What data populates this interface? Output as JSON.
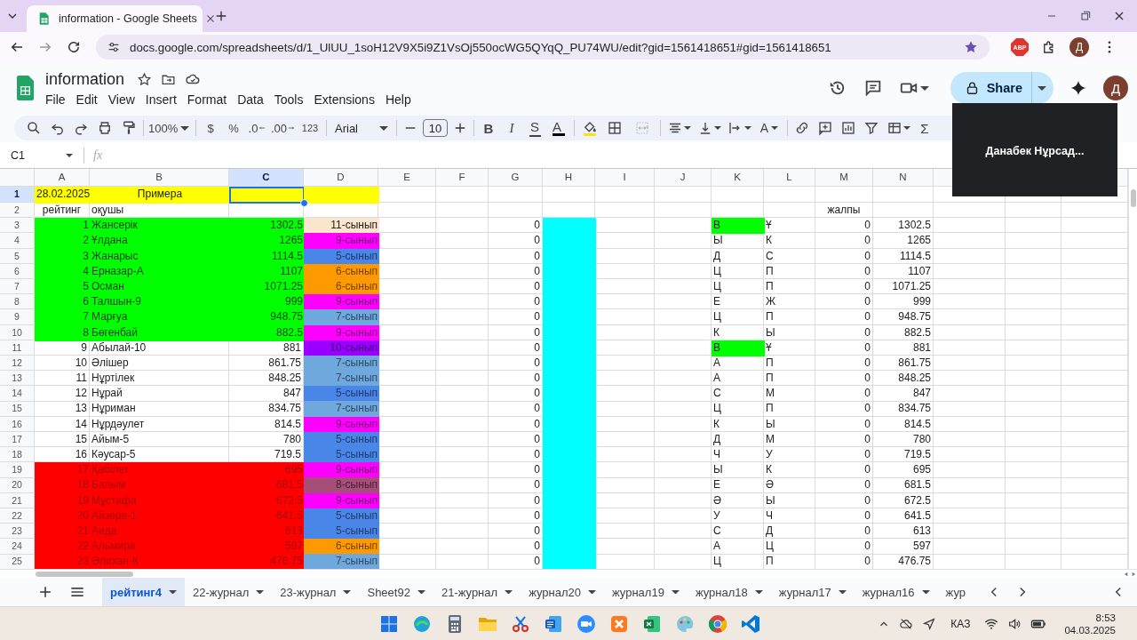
{
  "browser": {
    "tab_title": "information - Google Sheets",
    "url": "docs.google.com/spreadsheets/d/1_UlUU_1soH12V9X5i9Z1VsOj550ocWG5QYqQ_PU74WU/edit?gid=1561418651#gid=1561418651",
    "extension_badge": "ABP",
    "profile_initial": "Д"
  },
  "document": {
    "title": "information",
    "menu": [
      "File",
      "Edit",
      "View",
      "Insert",
      "Format",
      "Data",
      "Tools",
      "Extensions",
      "Help"
    ],
    "share_label": "Share",
    "account_initial": "Д"
  },
  "toolbar": {
    "zoom": "100%",
    "currency": "$",
    "percent": "%",
    "decrease_decimals": ".0",
    "increase_decimals": ".00",
    "number_format": "123",
    "font": "Arial",
    "font_size": "10",
    "bold": "B",
    "italic": "I",
    "strikethrough": "S",
    "text_color": "A",
    "text_rotation": "A",
    "sum": "Σ"
  },
  "formula_bar": {
    "cell_ref": "C1",
    "fx": "fx"
  },
  "video_tile": {
    "name": "Данабек Нұрсад..."
  },
  "grid": {
    "columns": [
      {
        "letter": "A",
        "selected": false
      },
      {
        "letter": "B",
        "selected": false
      },
      {
        "letter": "C",
        "selected": true
      },
      {
        "letter": "D",
        "selected": false
      },
      {
        "letter": "E",
        "selected": false
      },
      {
        "letter": "F",
        "selected": false
      },
      {
        "letter": "G",
        "selected": false
      },
      {
        "letter": "H",
        "selected": false
      },
      {
        "letter": "I",
        "selected": false
      },
      {
        "letter": "J",
        "selected": false
      },
      {
        "letter": "K",
        "selected": false
      },
      {
        "letter": "L",
        "selected": false
      },
      {
        "letter": "M",
        "selected": false
      },
      {
        "letter": "N",
        "selected": false
      }
    ],
    "rows": [
      {
        "number": "1",
        "selected": true,
        "kind": "title",
        "date": "28.02.2025",
        "subject": "Примера"
      },
      {
        "number": "2",
        "selected": false,
        "kind": "labels",
        "rank_label": "рейтинг",
        "name_label": "оқушы",
        "total_label": "жалпы"
      },
      {
        "number": "3",
        "selected": false,
        "kind": "leader",
        "rank": "1",
        "name": "Жансерік",
        "score": "1302.5",
        "class_label": "11-сынып",
        "color": "#fce5cd",
        "col_g": "0",
        "col_k": "В",
        "k_highlighted": true,
        "col_l": "Ұ",
        "col_m": "0",
        "col_n": "1302.5"
      },
      {
        "number": "4",
        "selected": false,
        "kind": "leader",
        "rank": "2",
        "name": "Ұлдана",
        "score": "1265",
        "class_label": "9-сынып",
        "color": "#ff00ff",
        "col_g": "0",
        "col_k": "Ы",
        "k_highlighted": false,
        "col_l": "К",
        "col_m": "0",
        "col_n": "1265"
      },
      {
        "number": "5",
        "selected": false,
        "kind": "leader",
        "rank": "3",
        "name": "Жанарыс",
        "score": "1114.5",
        "class_label": "5-сынып",
        "color": "#4a86e8",
        "col_g": "0",
        "col_k": "Д",
        "k_highlighted": false,
        "col_l": "С",
        "col_m": "0",
        "col_n": "1114.5"
      },
      {
        "number": "6",
        "selected": false,
        "kind": "leader",
        "rank": "4",
        "name": "Ерназар-А",
        "score": "1107",
        "class_label": "6-сынып",
        "color": "#ff9900",
        "col_g": "0",
        "col_k": "Ц",
        "k_highlighted": false,
        "col_l": "П",
        "col_m": "0",
        "col_n": "1107"
      },
      {
        "number": "7",
        "selected": false,
        "kind": "leader",
        "rank": "5",
        "name": "Осман",
        "score": "1071.25",
        "class_label": "6-сынып",
        "color": "#ff9900",
        "col_g": "0",
        "col_k": "Ц",
        "k_highlighted": false,
        "col_l": "П",
        "col_m": "0",
        "col_n": "1071.25"
      },
      {
        "number": "8",
        "selected": false,
        "kind": "leader",
        "rank": "6",
        "name": "Талшын-9",
        "score": "999",
        "class_label": "9-сынып",
        "color": "#ff00ff",
        "col_g": "0",
        "col_k": "Е",
        "k_highlighted": false,
        "col_l": "Ж",
        "col_m": "0",
        "col_n": "999"
      },
      {
        "number": "9",
        "selected": false,
        "kind": "leader",
        "rank": "7",
        "name": "Марғуа",
        "score": "948.75",
        "class_label": "7-сынып",
        "color": "#6fa8dc",
        "col_g": "0",
        "col_k": "Ц",
        "k_highlighted": false,
        "col_l": "П",
        "col_m": "0",
        "col_n": "948.75"
      },
      {
        "number": "10",
        "selected": false,
        "kind": "leader",
        "rank": "8",
        "name": "Бөгенбай",
        "score": "882.5",
        "class_label": "9-сынып",
        "color": "#ff00ff",
        "col_g": "0",
        "col_k": "К",
        "k_highlighted": false,
        "col_l": "Ы",
        "col_m": "0",
        "col_n": "882.5"
      },
      {
        "number": "11",
        "selected": false,
        "kind": "regular",
        "rank": "9",
        "name": "Абылай-10",
        "score": "881",
        "class_label": "10-сынып",
        "color": "#9900ff",
        "col_g": "0",
        "col_k": "В",
        "k_highlighted": true,
        "col_l": "Ұ",
        "col_m": "0",
        "col_n": "881"
      },
      {
        "number": "12",
        "selected": false,
        "kind": "regular",
        "rank": "10",
        "name": "Әлішер",
        "score": "861.75",
        "class_label": "7-сынып",
        "color": "#6fa8dc",
        "col_g": "0",
        "col_k": "А",
        "k_highlighted": false,
        "col_l": "П",
        "col_m": "0",
        "col_n": "861.75"
      },
      {
        "number": "13",
        "selected": false,
        "kind": "regular",
        "rank": "11",
        "name": "Нұртілек",
        "score": "848.25",
        "class_label": "7-сынып",
        "color": "#6fa8dc",
        "col_g": "0",
        "col_k": "А",
        "k_highlighted": false,
        "col_l": "П",
        "col_m": "0",
        "col_n": "848.25"
      },
      {
        "number": "14",
        "selected": false,
        "kind": "regular",
        "rank": "12",
        "name": "Нұрай",
        "score": "847",
        "class_label": "5-сынып",
        "color": "#4a86e8",
        "col_g": "0",
        "col_k": "С",
        "k_highlighted": false,
        "col_l": "М",
        "col_m": "0",
        "col_n": "847"
      },
      {
        "number": "15",
        "selected": false,
        "kind": "regular",
        "rank": "13",
        "name": "Нұриман",
        "score": "834.75",
        "class_label": "7-сынып",
        "color": "#6fa8dc",
        "col_g": "0",
        "col_k": "Ц",
        "k_highlighted": false,
        "col_l": "П",
        "col_m": "0",
        "col_n": "834.75"
      },
      {
        "number": "16",
        "selected": false,
        "kind": "regular",
        "rank": "14",
        "name": "Нұрдәулет",
        "score": "814.5",
        "class_label": "9-сынып",
        "color": "#ff00ff",
        "col_g": "0",
        "col_k": "К",
        "k_highlighted": false,
        "col_l": "Ы",
        "col_m": "0",
        "col_n": "814.5"
      },
      {
        "number": "17",
        "selected": false,
        "kind": "regular",
        "rank": "15",
        "name": "Айым-5",
        "score": "780",
        "class_label": "5-сынып",
        "color": "#4a86e8",
        "col_g": "0",
        "col_k": "Д",
        "k_highlighted": false,
        "col_l": "М",
        "col_m": "0",
        "col_n": "780"
      },
      {
        "number": "18",
        "selected": false,
        "kind": "regular",
        "rank": "16",
        "name": "Кәусар-5",
        "score": "719.5",
        "class_label": "5-сынып",
        "color": "#4a86e8",
        "col_g": "0",
        "col_k": "Ч",
        "k_highlighted": false,
        "col_l": "У",
        "col_m": "0",
        "col_n": "719.5"
      },
      {
        "number": "19",
        "selected": false,
        "kind": "lagging",
        "rank": "17",
        "name": "Қабілет",
        "score": "695",
        "class_label": "9-сынып",
        "color": "#ff00ff",
        "col_g": "0",
        "col_k": "Ы",
        "k_highlighted": false,
        "col_l": "К",
        "col_m": "0",
        "col_n": "695"
      },
      {
        "number": "20",
        "selected": false,
        "kind": "lagging",
        "rank": "18",
        "name": "Балым",
        "score": "681.5",
        "class_label": "8-сынып",
        "color": "#a64d79",
        "col_g": "0",
        "col_k": "Е",
        "k_highlighted": false,
        "col_l": "Ә",
        "col_m": "0",
        "col_n": "681.5"
      },
      {
        "number": "21",
        "selected": false,
        "kind": "lagging",
        "rank": "19",
        "name": "Мұстафа",
        "score": "672.5",
        "class_label": "9-сынып",
        "color": "#ff00ff",
        "col_g": "0",
        "col_k": "Ә",
        "k_highlighted": false,
        "col_l": "Ы",
        "col_m": "0",
        "col_n": "672.5"
      },
      {
        "number": "22",
        "selected": false,
        "kind": "lagging",
        "rank": "20",
        "name": "Айзере-1",
        "score": "641.5",
        "class_label": "5-сынып",
        "color": "#4a86e8",
        "col_g": "0",
        "col_k": "У",
        "k_highlighted": false,
        "col_l": "Ч",
        "col_m": "0",
        "col_n": "641.5"
      },
      {
        "number": "23",
        "selected": false,
        "kind": "lagging",
        "rank": "21",
        "name": "Аида",
        "score": "613",
        "class_label": "5-сынып",
        "color": "#4a86e8",
        "col_g": "0",
        "col_k": "С",
        "k_highlighted": false,
        "col_l": "Д",
        "col_m": "0",
        "col_n": "613"
      },
      {
        "number": "24",
        "selected": false,
        "kind": "lagging",
        "rank": "22",
        "name": "Альмира",
        "score": "597",
        "class_label": "6-сынып",
        "color": "#ff9900",
        "col_g": "0",
        "col_k": "А",
        "k_highlighted": false,
        "col_l": "Ц",
        "col_m": "0",
        "col_n": "597"
      },
      {
        "number": "25",
        "selected": false,
        "kind": "lagging",
        "rank": "23",
        "name": "Әлихан-К",
        "score": "476.75",
        "class_label": "7-сынып",
        "color": "#6fa8dc",
        "col_g": "0",
        "col_k": "Ц",
        "k_highlighted": false,
        "col_l": "П",
        "col_m": "0",
        "col_n": "476.75"
      }
    ]
  },
  "sheet_tabs": [
    {
      "label": "рейтинг4",
      "selected": true
    },
    {
      "label": "22-журнал",
      "selected": false
    },
    {
      "label": "23-журнал",
      "selected": false
    },
    {
      "label": "Sheet92",
      "selected": false
    },
    {
      "label": "21-журнал",
      "selected": false
    },
    {
      "label": "журнал20",
      "selected": false
    },
    {
      "label": "журнал19",
      "selected": false
    },
    {
      "label": "журнал18",
      "selected": false
    },
    {
      "label": "журнал17",
      "selected": false
    },
    {
      "label": "журнал16",
      "selected": false
    },
    {
      "label": "жур",
      "selected": false
    }
  ],
  "taskbar": {
    "language": "КАЗ",
    "time": "8:53",
    "date": "04.03.2025"
  }
}
